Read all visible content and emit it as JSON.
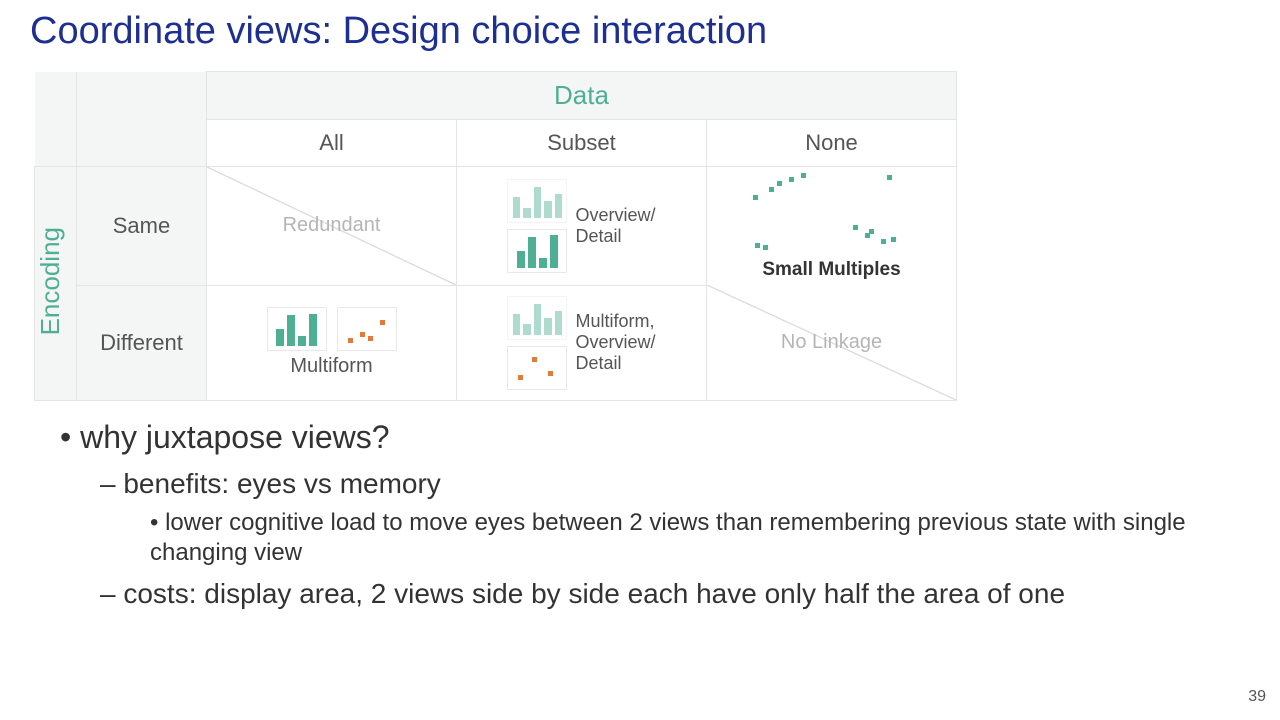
{
  "title": "Coordinate views: Design choice interaction",
  "table": {
    "top_header": "Data",
    "side_header": "Encoding",
    "cols": [
      "All",
      "Subset",
      "None"
    ],
    "rows": [
      "Same",
      "Different"
    ],
    "cells": {
      "same_all": "Redundant",
      "same_subset": "Overview/\nDetail",
      "small_multiples": "Small Multiples",
      "diff_all": "Multiform",
      "diff_subset": "Multiform,\nOverview/\nDetail",
      "diff_none": "No Linkage"
    }
  },
  "bullets": {
    "q": "why juxtapose views?",
    "b1": "benefits: eyes vs memory",
    "b1a": "lower cognitive load to move eyes between 2 views than remembering previous state with single changing view",
    "b2": "costs: display area, 2 views side by side each have only half the area of one"
  },
  "page_number": "39"
}
